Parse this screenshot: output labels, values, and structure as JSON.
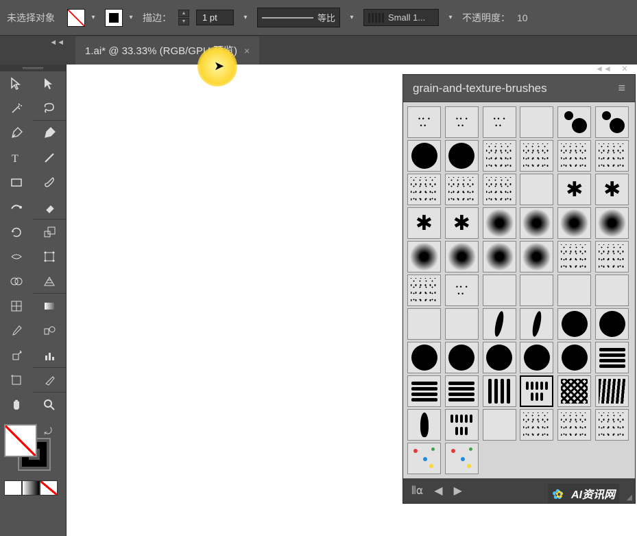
{
  "topbar": {
    "no_selection": "未选择对象",
    "stroke_label": "描边：",
    "stroke_value": "1 pt",
    "profile_label": "等比",
    "brush_preset": "Small 1...",
    "opacity_label": "不透明度：",
    "opacity_value": "10"
  },
  "tab": {
    "title": "1.ai* @ 33.33% (RGB/GPU 预览)",
    "close": "×"
  },
  "panel": {
    "title": "grain-and-texture-brushes",
    "collapse": "◄◄",
    "close": "✕"
  },
  "footer": {
    "library": "⫴⍺",
    "prev": "◀",
    "next": "▶"
  },
  "watermark": {
    "text": "AI资讯网"
  },
  "tools": {
    "collapse": "◄◄"
  }
}
